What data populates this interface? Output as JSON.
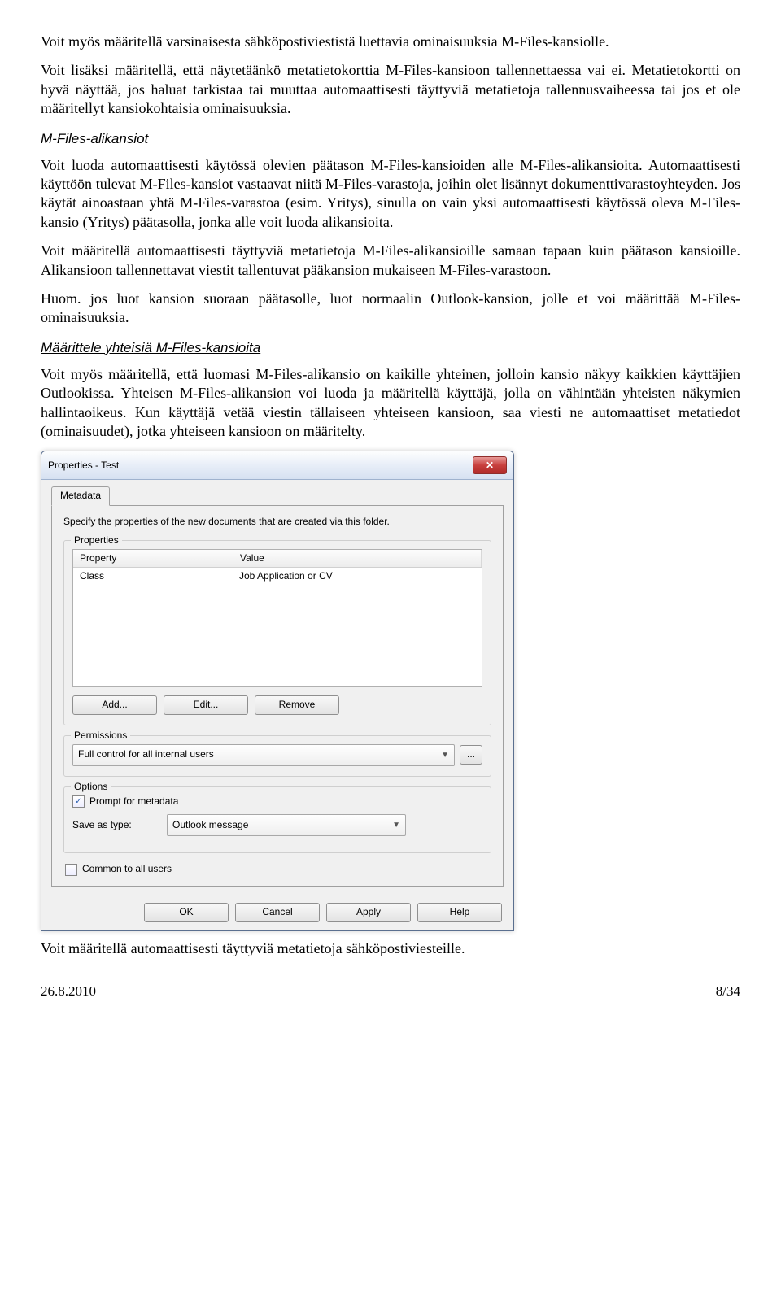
{
  "paragraphs": {
    "p1": "Voit myös määritellä varsinaisesta sähköpostiviestistä luettavia ominaisuuksia M-Files-kansiolle.",
    "p2": "Voit lisäksi määritellä, että näytetäänkö metatietokorttia M-Files-kansioon tallennettaessa vai ei. Metatietokortti on hyvä näyttää, jos haluat tarkistaa tai muuttaa automaattisesti täyttyviä metatietoja tallennusvaiheessa tai jos et ole määritellyt kansiokohtaisia ominaisuuksia.",
    "h1": "M-Files-alikansiot",
    "p3": "Voit luoda automaattisesti käytössä olevien päätason M-Files-kansioiden alle M-Files-alikansioita. Automaattisesti käyttöön tulevat M-Files-kansiot vastaavat niitä M-Files-varastoja, joihin olet lisännyt dokumenttivarastoyhteyden. Jos käytät ainoastaan yhtä M-Files-varastoa (esim. Yritys), sinulla on vain yksi automaattisesti käytössä oleva M-Files-kansio (Yritys) päätasolla, jonka alle voit luoda alikansioita.",
    "p4": "Voit määritellä automaattisesti täyttyviä metatietoja M-Files-alikansioille samaan tapaan kuin päätason kansioille. Alikansioon tallennettavat viestit tallentuvat pääkansion mukaiseen M-Files-varastoon.",
    "p5": "Huom. jos luot kansion suoraan päätasolle, luot normaalin Outlook-kansion, jolle et voi määrittää M-Files-ominaisuuksia.",
    "h2": "Määrittele yhteisiä M-Files-kansioita",
    "p6": "Voit myös määritellä, että luomasi M-Files-alikansio on kaikille yhteinen, jolloin kansio näkyy kaikkien käyttäjien Outlookissa. Yhteisen M-Files-alikansion voi luoda ja määritellä käyttäjä, jolla on vähintään yhteisten näkymien hallintaoikeus. Kun käyttäjä vetää viestin tällaiseen yhteiseen kansioon, saa viesti ne automaattiset metatiedot (ominaisuudet), jotka yhteiseen kansioon on määritelty.",
    "p7": "Voit määritellä automaattisesti täyttyviä metatietoja sähköpostiviesteille."
  },
  "dialog": {
    "title": "Properties - Test",
    "tab": "Metadata",
    "instruction": "Specify the properties of the new documents that are created via this folder.",
    "groups": {
      "properties": "Properties",
      "permissions": "Permissions",
      "options": "Options"
    },
    "table": {
      "col1": "Property",
      "col2": "Value",
      "row1c1": "Class",
      "row1c2": "Job Application or CV"
    },
    "buttons": {
      "add": "Add...",
      "edit": "Edit...",
      "remove": "Remove",
      "more": "...",
      "ok": "OK",
      "cancel": "Cancel",
      "apply": "Apply",
      "help": "Help"
    },
    "permissions_value": "Full control for all internal users",
    "options": {
      "prompt": "Prompt for metadata",
      "saveas_label": "Save as type:",
      "saveas_value": "Outlook message",
      "common": "Common to all users"
    }
  },
  "footer": {
    "date": "26.8.2010",
    "page": "8/34"
  }
}
